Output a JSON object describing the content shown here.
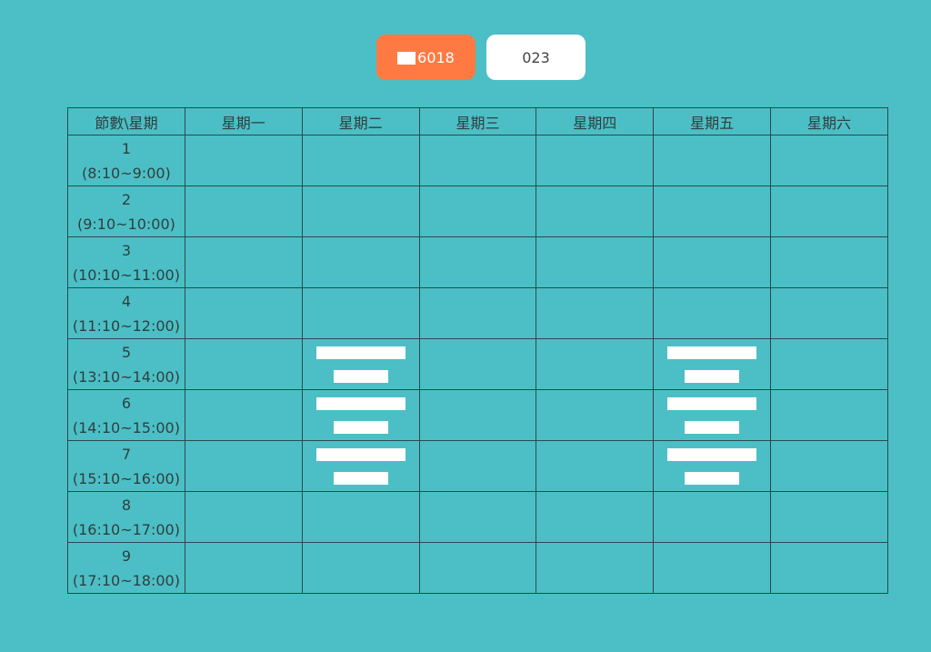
{
  "toolbar": {
    "left_button_label": "6018",
    "right_button_label": "023"
  },
  "table": {
    "headers": [
      "節數\\星期",
      "星期一",
      "星期二",
      "星期三",
      "星期四",
      "星期五",
      "星期六"
    ],
    "periods": [
      {
        "num": "1",
        "time": "(8:10~9:00)"
      },
      {
        "num": "2",
        "time": "(9:10~10:00)"
      },
      {
        "num": "3",
        "time": "(10:10~11:00)"
      },
      {
        "num": "4",
        "time": "(11:10~12:00)"
      },
      {
        "num": "5",
        "time": "(13:10~14:00)"
      },
      {
        "num": "6",
        "time": "(14:10~15:00)"
      },
      {
        "num": "7",
        "time": "(15:10~16:00)"
      },
      {
        "num": "8",
        "time": "(16:10~17:00)"
      },
      {
        "num": "9",
        "time": "(17:10~18:00)"
      }
    ],
    "occupied_slots": [
      {
        "period": 5,
        "day": 2
      },
      {
        "period": 6,
        "day": 2
      },
      {
        "period": 7,
        "day": 2
      },
      {
        "period": 5,
        "day": 5
      },
      {
        "period": 6,
        "day": 5
      },
      {
        "period": 7,
        "day": 5
      }
    ]
  },
  "colors": {
    "background": "#4bbfc5",
    "accent_button": "#ff7a42",
    "secondary_button": "#ffffff",
    "grid_line": "#2a4a4c"
  }
}
